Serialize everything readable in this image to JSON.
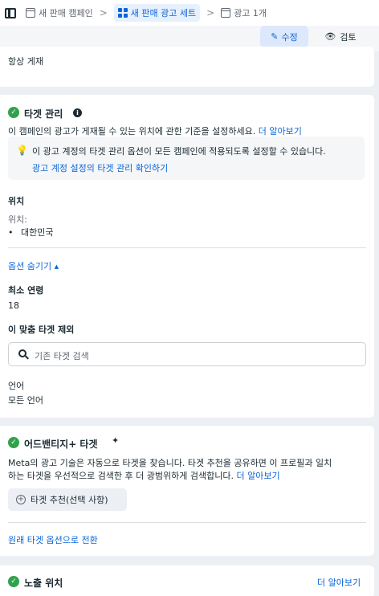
{
  "breadcrumb": {
    "campaign": "새 판매 캠페인",
    "adset": "새 판매 광고 세트",
    "ad": "광고 1개",
    "separator": ">"
  },
  "actions": {
    "edit_label": "수정",
    "review_label": "검토"
  },
  "placement_top": {
    "text": "항상 게재"
  },
  "targeting": {
    "title": "타겟 관리",
    "description": "이 캠페인의 광고가 게재될 수 있는 위치에 관한 기준을 설정하세요.",
    "learn_more": "더 알아보기",
    "notice_text": "이 광고 계정의 타겟 관리 옵션이 모든 캠페인에 적용되도록 설정할 수 있습니다.",
    "notice_link": "광고 계정 설정의 타겟 관리 확인하기",
    "location_heading": "위치",
    "location_label": "위치:",
    "location_value": "대한민국",
    "hide_options": "옵션 숨기기 ▴",
    "min_age_heading": "최소 연령",
    "min_age_value": "18",
    "exclude_heading": "이 맞춤 타겟 제외",
    "search_placeholder": "기존 타겟 검색",
    "language_heading": "언어",
    "language_value": "모든 언어"
  },
  "advantage": {
    "title": "어드밴티지+ 타겟",
    "description_line1": "Meta의 광고 기술은 자동으로 타겟을 찾습니다. 타겟 추천을 공유하면 이 프로필과 일치",
    "description_line2": "하는 타겟을 우선적으로 검색한 후 더 광범위하게 검색합니다.",
    "learn_more": "더 알아보기",
    "recommend_button": "타겟 추천(선택 사항)",
    "switch_link": "원래 타겟 옵션으로 전환"
  },
  "exposure": {
    "title": "노출 위치",
    "learn_more": "더 알아보기"
  },
  "colors": {
    "accent": "#0a66d8",
    "success": "#31a24c",
    "background": "#eceff3"
  }
}
